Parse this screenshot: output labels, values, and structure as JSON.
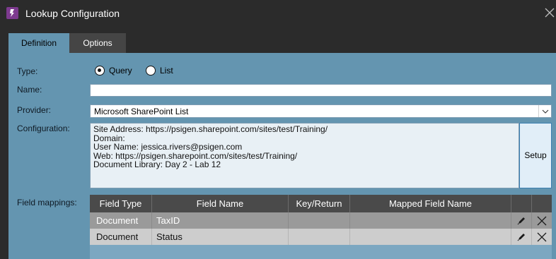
{
  "window": {
    "title": "Lookup Configuration",
    "app_icon": "psigen-logo-icon",
    "close_icon": "close-icon"
  },
  "tabs": [
    {
      "label": "Definition",
      "active": true
    },
    {
      "label": "Options",
      "active": false
    }
  ],
  "form": {
    "type_label": "Type:",
    "type_options": [
      {
        "label": "Query",
        "selected": true
      },
      {
        "label": "List",
        "selected": false
      }
    ],
    "name_label": "Name:",
    "name_value": "",
    "provider_label": "Provider:",
    "provider_value": "Microsoft SharePoint List",
    "configuration_label": "Configuration:",
    "configuration_lines": [
      "Site Address: https://psigen.sharepoint.com/sites/test/Training/",
      "Domain:",
      "User Name: jessica.rivers@psigen.com",
      "Web: https://psigen.sharepoint.com/sites/test/Training/",
      "Document Library: Day 2 - Lab 12"
    ],
    "setup_label": "Setup",
    "field_mappings_label": "Field mappings:"
  },
  "mappings": {
    "columns": [
      "Field Type",
      "Field Name",
      "Key/Return",
      "Mapped Field Name"
    ],
    "rows": [
      {
        "field_type": "Document",
        "field_name": "TaxID",
        "key_return": "",
        "mapped_field_name": "",
        "selected": true
      },
      {
        "field_type": "Document",
        "field_name": "Status",
        "key_return": "",
        "mapped_field_name": "",
        "selected": false
      }
    ],
    "edit_icon": "pencil-icon",
    "delete_icon": "delete-x-icon"
  },
  "colors": {
    "titlebar": "#2b2b2b",
    "panel": "#6495b0",
    "grid_header": "#4a4a4a",
    "selected_row": "#9a9a9a",
    "row": "#cdcdcd",
    "app_icon": "#7d3a8f"
  }
}
